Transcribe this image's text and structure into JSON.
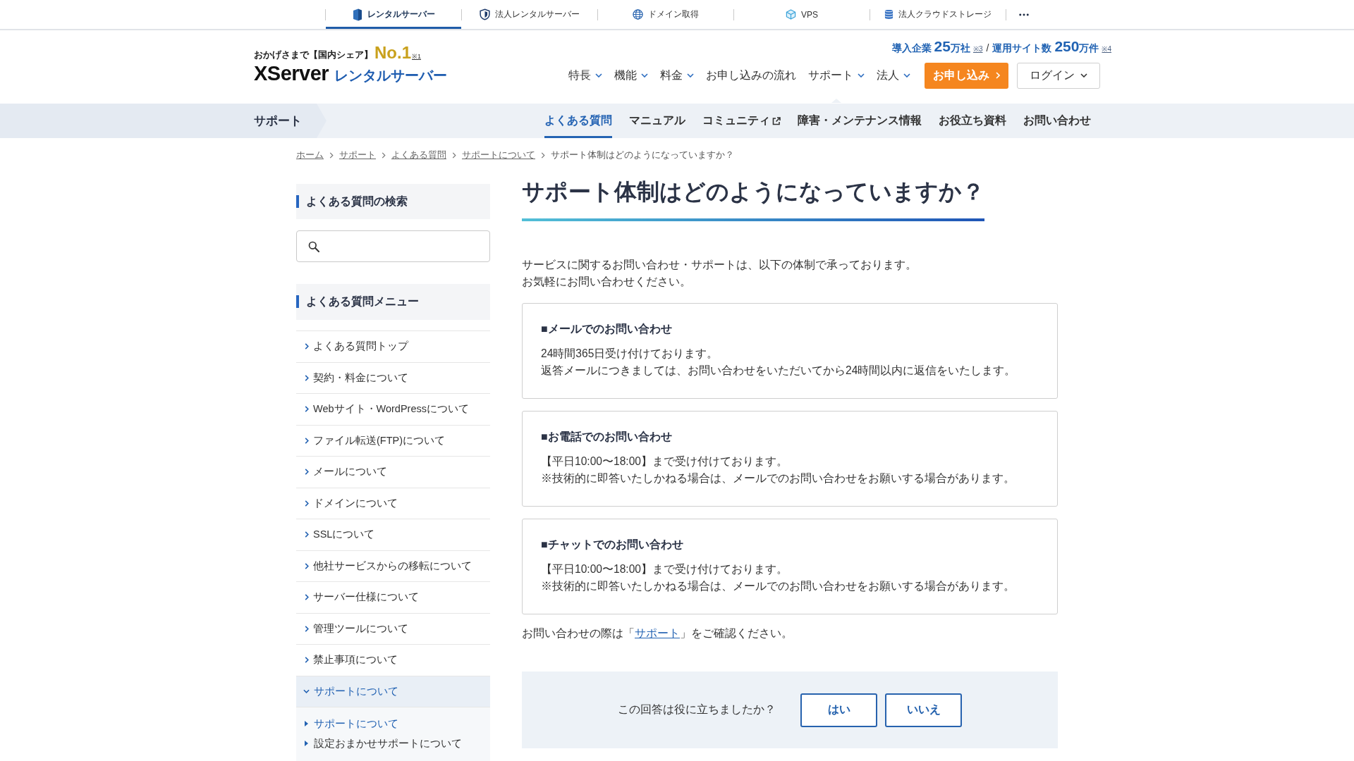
{
  "service_tabs": [
    {
      "label": "レンタルサーバー",
      "selected": true
    },
    {
      "label": "法人レンタルサーバー",
      "selected": false
    },
    {
      "label": "ドメイン取得",
      "selected": false
    },
    {
      "label": "VPS",
      "selected": false
    },
    {
      "label": "法人クラウドストレージ",
      "selected": false
    }
  ],
  "header": {
    "tagline": "おかげさまで【国内シェア】",
    "rank": "No.1",
    "rank_note": "※1",
    "logo_brand": "XServer",
    "logo_product": "レンタルサーバー",
    "stats": [
      {
        "label": "導入企業",
        "number": "25",
        "unit": "万社",
        "note": "※3"
      },
      {
        "label": "運用サイト数",
        "number": "250",
        "unit": "万件",
        "note": "※4"
      }
    ],
    "stats_separator": "/"
  },
  "main_nav": [
    {
      "label": "特長",
      "dropdown": true,
      "selected": false
    },
    {
      "label": "機能",
      "dropdown": true,
      "selected": false
    },
    {
      "label": "料金",
      "dropdown": true,
      "selected": false
    },
    {
      "label": "お申し込みの流れ",
      "dropdown": false,
      "selected": false
    },
    {
      "label": "サポート",
      "dropdown": true,
      "selected": true
    },
    {
      "label": "法人",
      "dropdown": true,
      "selected": false
    }
  ],
  "apply_button": "お申し込み",
  "login_button": "ログイン",
  "support_nav": {
    "section": "サポート",
    "items": [
      {
        "label": "よくある質問",
        "selected": true,
        "external": false
      },
      {
        "label": "マニュアル",
        "selected": false,
        "external": false
      },
      {
        "label": "コミュニティ",
        "selected": false,
        "external": true
      },
      {
        "label": "障害・メンテナンス情報",
        "selected": false,
        "external": false
      },
      {
        "label": "お役立ち資料",
        "selected": false,
        "external": false
      },
      {
        "label": "お問い合わせ",
        "selected": false,
        "external": false
      }
    ]
  },
  "breadcrumb": [
    {
      "label": "ホーム",
      "current": false
    },
    {
      "label": "サポート",
      "current": false
    },
    {
      "label": "よくある質問",
      "current": false
    },
    {
      "label": "サポートについて",
      "current": false
    },
    {
      "label": "サポート体制はどのようになっていますか？",
      "current": true
    }
  ],
  "sidebar": {
    "search_heading": "よくある質問の検索",
    "menu_heading": "よくある質問メニュー",
    "menu": [
      {
        "label": "よくある質問トップ",
        "expanded": false
      },
      {
        "label": "契約・料金について",
        "expanded": false
      },
      {
        "label": "Webサイト・WordPressについて",
        "expanded": false
      },
      {
        "label": "ファイル転送(FTP)について",
        "expanded": false
      },
      {
        "label": "メールについて",
        "expanded": false
      },
      {
        "label": "ドメインについて",
        "expanded": false
      },
      {
        "label": "SSLについて",
        "expanded": false
      },
      {
        "label": "他社サービスからの移転について",
        "expanded": false
      },
      {
        "label": "サーバー仕様について",
        "expanded": false
      },
      {
        "label": "管理ツールについて",
        "expanded": false
      },
      {
        "label": "禁止事項について",
        "expanded": false
      },
      {
        "label": "サポートについて",
        "expanded": true,
        "children": [
          {
            "label": "サポートについて",
            "selected": true
          },
          {
            "label": "設定おまかせサポートについて",
            "selected": false
          }
        ]
      }
    ]
  },
  "article": {
    "title": "サポート体制はどのようになっていますか？",
    "intro": [
      "サービスに関するお問い合わせ・サポートは、以下の体制で承っております。",
      "お気軽にお問い合わせください。"
    ],
    "sections": [
      {
        "heading": "■メールでのお問い合わせ",
        "lines": [
          "24時間365日受け付けております。",
          "返答メールにつきましては、お問い合わせをいただいてから24時間以内に返信をいたします。"
        ]
      },
      {
        "heading": "■お電話でのお問い合わせ",
        "lines": [
          "【平日10:00〜18:00】まで受け付けております。",
          "※技術的に即答いたしかねる場合は、メールでのお問い合わせをお願いする場合があります。"
        ]
      },
      {
        "heading": "■チャットでのお問い合わせ",
        "lines": [
          "【平日10:00〜18:00】まで受け付けております。",
          "※技術的に即答いたしかねる場合は、メールでのお問い合わせをお願いする場合があります。"
        ]
      }
    ],
    "closing": {
      "before": "お問い合わせの際は「",
      "link": "サポート",
      "after": "」をご確認ください。"
    }
  },
  "feedback": {
    "question": "この回答は役に立ちましたか？",
    "buttons": [
      "はい",
      "いいえ"
    ]
  }
}
